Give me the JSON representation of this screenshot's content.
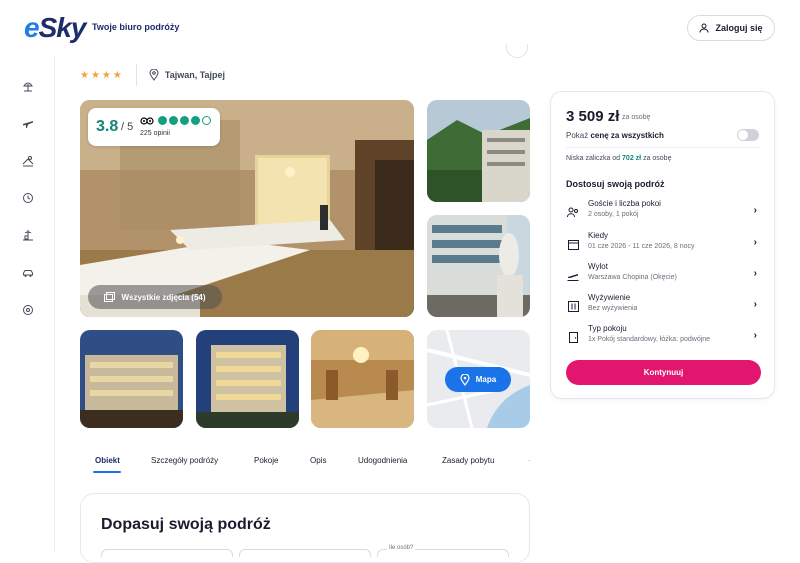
{
  "brand": {
    "logo_e": "e",
    "logo_rest": "Sky",
    "tagline": "Twoje biuro podróży",
    "accent": "#1f7fe3",
    "navy": "#1d2c6b"
  },
  "header": {
    "login_label": "Zaloguj się"
  },
  "sidebar": {
    "items": [
      {
        "icon": "beach-umbrella-icon"
      },
      {
        "icon": "plane-icon"
      },
      {
        "icon": "flight-hotel-icon"
      },
      {
        "icon": "last-minute-clock-icon"
      },
      {
        "icon": "resort-icon"
      },
      {
        "icon": "car-icon"
      },
      {
        "icon": "settings-icon"
      }
    ]
  },
  "hotel": {
    "stars": "★★★★",
    "location": "Tajwan, Tajpej"
  },
  "rating": {
    "score": "3.8",
    "out_of": "/ 5",
    "reviews": "225 opinii",
    "bubbles_full": 3,
    "bubbles_half": 1
  },
  "gallery": {
    "all_photos_label": "Wszystkie zdjęcia (54)",
    "map_label": "Mapa"
  },
  "tabs": [
    {
      "label": "Obiekt",
      "active": true
    },
    {
      "label": "Szczegóły podróży"
    },
    {
      "label": "Pokoje"
    },
    {
      "label": "Opis"
    },
    {
      "label": "Udogodnienia"
    },
    {
      "label": "Zasady pobytu"
    }
  ],
  "fit_section": {
    "title": "Dopasuj swoją podróż",
    "guests_label": "Ile osób?"
  },
  "booking": {
    "price": "3 509 zł",
    "per_person": "za osobę",
    "show_price_prefix": "Pokaż",
    "show_price_bold": "cenę za wszystkich",
    "deposit_prefix": "Niska zaliczka od",
    "deposit_amount": "702 zł",
    "deposit_suffix": "za osobę",
    "section_title": "Dostosuj swoją podróż",
    "options": [
      {
        "icon": "guests-icon",
        "label": "Goście i liczba pokoi",
        "value": "2 osoby, 1 pokój"
      },
      {
        "icon": "calendar-icon",
        "label": "Kiedy",
        "value": "01 cze 2026 - 11 cze 2026, 8 nocy"
      },
      {
        "icon": "departure-icon",
        "label": "Wylot",
        "value": "Warszawa Chopina (Okęcie)"
      },
      {
        "icon": "meal-icon",
        "label": "Wyżywienie",
        "value": "Bez wyżywienia"
      },
      {
        "icon": "room-icon",
        "label": "Typ pokoju",
        "value": "1x Pokój standardowy, łóżka: podwójne"
      }
    ],
    "continue_label": "Kontynuuj",
    "cta_color": "#e2166f"
  }
}
